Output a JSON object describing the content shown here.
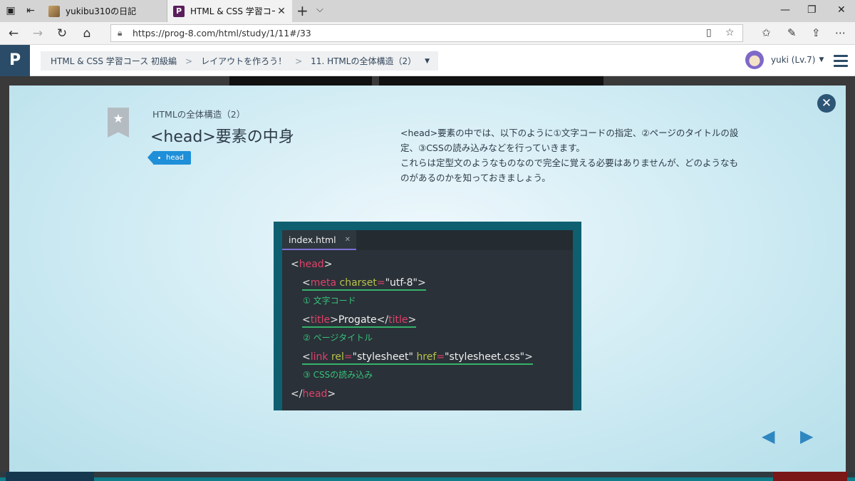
{
  "browser": {
    "tabs": [
      {
        "label": "yukibu310の日記",
        "active": false
      },
      {
        "label": "HTML & CSS 学習コース:",
        "active": true
      }
    ],
    "url": "https://prog-8.com/html/study/1/11#/33"
  },
  "header": {
    "logo": "P",
    "breadcrumb": [
      "HTML & CSS 学習コース 初級編",
      "レイアウトを作ろう！",
      "11. HTMLの全体構造（2）"
    ],
    "user": "yuki (Lv.7)"
  },
  "slide": {
    "subtitle": "HTMLの全体構造（2）",
    "title": "<head>要素の中身",
    "tag": "head",
    "description": "<head>要素の中では、以下のように①文字コードの指定、②ページのタイトルの設定、③CSSの読み込みなどを行っていきます。\nこれらは定型文のようなものなので完全に覚える必要はありませんが、どのようなものがあるのかを知っておきましょう。",
    "editor": {
      "filename": "index.html",
      "comments": [
        "① 文字コード",
        "② ページタイトル",
        "③ CSSの読み込み"
      ],
      "code": {
        "open_head_tag": "head",
        "meta_tag": "meta",
        "meta_attr": "charset",
        "meta_value": "\"utf-8\"",
        "title_tag": "title",
        "title_text": "Progate",
        "link_tag": "link",
        "link_rel_attr": "rel",
        "link_rel_value": "\"stylesheet\"",
        "link_href_attr": "href",
        "link_href_value": "\"stylesheet.css\"",
        "close_head_tag": "head"
      }
    },
    "colors": {
      "tag_keyword": "#e0416a",
      "attribute": "#b9c24a",
      "comment": "#35c27a",
      "accent": "#1e8fd8"
    }
  }
}
